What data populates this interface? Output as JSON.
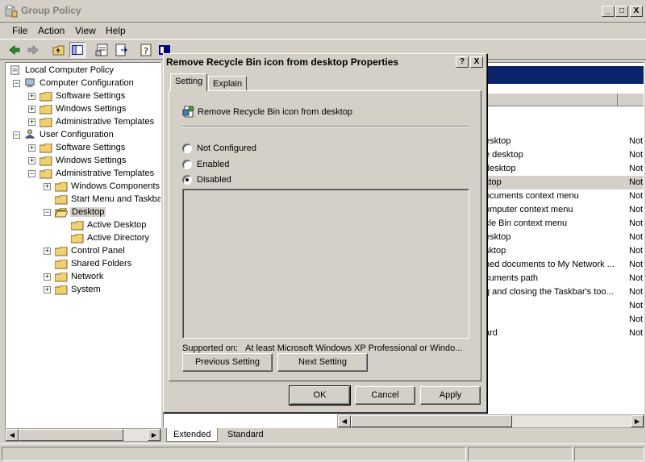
{
  "window": {
    "title": "Group Policy",
    "caption_minimize": "_",
    "caption_maximize": "□",
    "caption_close": "X"
  },
  "menu": [
    "File",
    "Action",
    "View",
    "Help"
  ],
  "toolbar": {
    "icons": [
      "back-icon",
      "forward-icon",
      "up-folder-icon",
      "show-hide-tree-icon",
      "properties-icon",
      "export-list-icon",
      "help-icon",
      "extended-view-icon"
    ]
  },
  "tree": {
    "root": "Local Computer Policy",
    "computer_config": "Computer Configuration",
    "cc_software": "Software Settings",
    "cc_windows": "Windows Settings",
    "cc_admin": "Administrative Templates",
    "user_config": "User Configuration",
    "uc_software": "Software Settings",
    "uc_windows": "Windows Settings",
    "uc_admin": "Administrative Templates",
    "windows_components": "Windows Components",
    "start_menu": "Start Menu and Taskbar",
    "desktop": "Desktop",
    "active_desktop": "Active Desktop",
    "active_directory": "Active Directory",
    "control_panel": "Control Panel",
    "shared_folders": "Shared Folders",
    "network": "Network",
    "system": "System"
  },
  "list": {
    "rows": [
      {
        "name": "esktop",
        "state": "Not"
      },
      {
        "name": "e desktop",
        "state": "Not"
      },
      {
        "name": "desktop",
        "state": "Not"
      },
      {
        "name": "ktop",
        "state": "Not"
      },
      {
        "name": "ocuments context menu",
        "state": "Not"
      },
      {
        "name": "omputer context menu",
        "state": "Not"
      },
      {
        "name": "cle Bin context menu",
        "state": "Not"
      },
      {
        "name": "esktop",
        "state": "Not"
      },
      {
        "name": "sktop",
        "state": "Not"
      },
      {
        "name": "ned documents to My Network ...",
        "state": "Not"
      },
      {
        "name": "cuments path",
        "state": "Not"
      },
      {
        "name": "g and closing the Taskbar's too...",
        "state": "Not"
      },
      {
        "name": "",
        "state": "Not"
      },
      {
        "name": "",
        "state": "Not"
      },
      {
        "name": "ard",
        "state": "Not"
      }
    ]
  },
  "bottom_tabs": {
    "extended": "Extended",
    "standard": "Standard"
  },
  "dialog": {
    "title": "Remove Recycle Bin icon from desktop Properties",
    "help_btn": "?",
    "close_btn": "X",
    "tab_setting": "Setting",
    "tab_explain": "Explain",
    "policy_name": "Remove Recycle Bin icon from desktop",
    "options": {
      "not_configured": "Not Configured",
      "enabled": "Enabled",
      "disabled": "Disabled"
    },
    "selected_option": "disabled",
    "supported_label": "Supported on:",
    "supported_value": "At least Microsoft Windows XP Professional or Windo...",
    "prev_setting": "Previous Setting",
    "next_setting": "Next Setting",
    "ok": "OK",
    "cancel": "Cancel",
    "apply": "Apply"
  }
}
